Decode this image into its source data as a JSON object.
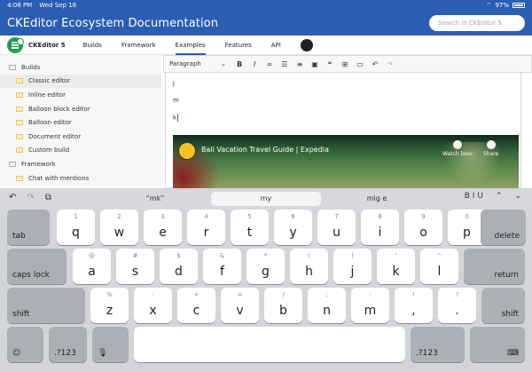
{
  "status": {
    "time": "4:08 PM",
    "date": "Wed Sep 18",
    "battery": "97%"
  },
  "header": {
    "title": "CKEditor Ecosystem Documentation",
    "search_placeholder": "Search in CKEditor 5"
  },
  "nav": {
    "product": "CKEditor 5",
    "items": [
      "Builds",
      "Framework",
      "Examples",
      "Features",
      "API"
    ],
    "active": "Examples"
  },
  "sidebar": {
    "groups": [
      {
        "label": "Builds",
        "children": [
          "Classic editor",
          "Inline editor",
          "Balloon block editor",
          "Balloon editor",
          "Document editor",
          "Custom build"
        ]
      },
      {
        "label": "Framework",
        "children": [
          "Chat with mentions"
        ]
      }
    ],
    "selected": "Classic editor"
  },
  "editor": {
    "paragraph": "Paragraph",
    "lines": [
      "j",
      "m",
      "k"
    ],
    "video_title": "Bali Vacation Travel Guide | Expedia",
    "video_actions": [
      "Watch later",
      "Share"
    ]
  },
  "predictive": {
    "suggestions": [
      "“mk”",
      "my",
      "mig e"
    ],
    "format_label": "B I U"
  },
  "keyboard": {
    "row1": [
      [
        "1",
        "q"
      ],
      [
        "2",
        "w"
      ],
      [
        "3",
        "e"
      ],
      [
        "4",
        "r"
      ],
      [
        "5",
        "t"
      ],
      [
        "6",
        "y"
      ],
      [
        "7",
        "u"
      ],
      [
        "8",
        "i"
      ],
      [
        "9",
        "o"
      ],
      [
        "0",
        "p"
      ]
    ],
    "row2": [
      [
        "@",
        "a"
      ],
      [
        "#",
        "s"
      ],
      [
        "$",
        "d"
      ],
      [
        "&",
        "f"
      ],
      [
        "*",
        "g"
      ],
      [
        "(",
        "h"
      ],
      [
        ")",
        "j"
      ],
      [
        "'",
        "k"
      ],
      [
        "\"",
        "l"
      ]
    ],
    "row3": [
      [
        "%",
        "z"
      ],
      [
        "-",
        "x"
      ],
      [
        "+",
        "c"
      ],
      [
        "=",
        "v"
      ],
      [
        "/",
        "b"
      ],
      [
        ";",
        "n"
      ],
      [
        ":",
        "m"
      ]
    ],
    "row3_extra": [
      [
        "!",
        ","
      ],
      [
        "?",
        "."
      ]
    ],
    "labels": {
      "tab": "tab",
      "delete": "delete",
      "caps": "caps lock",
      "return": "return",
      "shift": "shift",
      "num": ".?123"
    }
  }
}
